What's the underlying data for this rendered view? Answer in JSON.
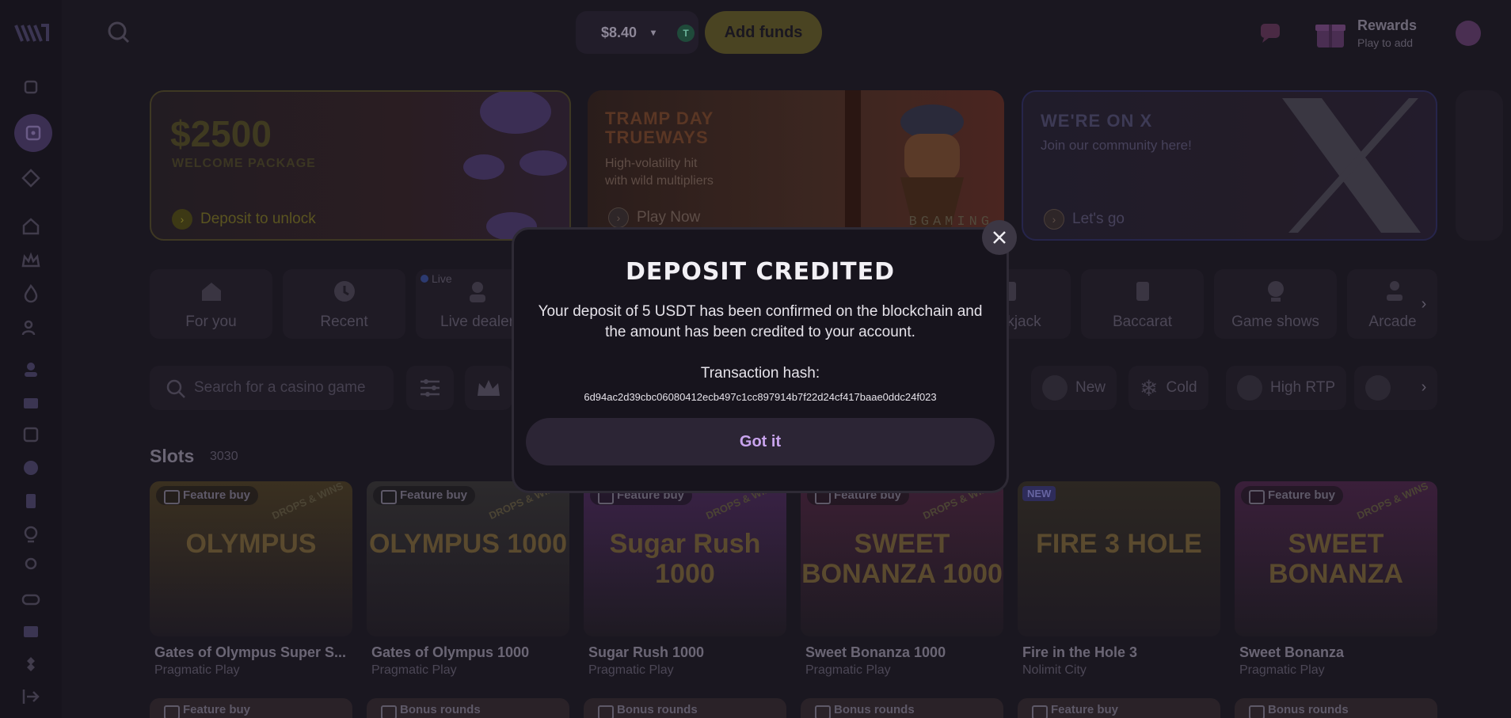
{
  "header": {
    "balance": "$8.40",
    "currency_badge": "T",
    "add_funds_label": "Add funds",
    "rewards_title": "Rewards",
    "rewards_sub": "Play to add"
  },
  "banners": [
    {
      "title": "$2500",
      "subtitle": "WELCOME PACKAGE",
      "cta": "Deposit to unlock"
    },
    {
      "title_line1": "TRAMP DAY",
      "title_line2": "TRUEWAYS",
      "desc_line1": "High-volatility hit",
      "desc_line2": "with wild multipliers",
      "cta": "Play Now",
      "brand": "BGAMING"
    },
    {
      "title": "WE'RE ON X",
      "desc": "Join our community here!",
      "cta": "Let's go"
    }
  ],
  "categories": [
    {
      "label": "For you",
      "icon": "house-icon"
    },
    {
      "label": "Recent",
      "icon": "clock-icon"
    },
    {
      "label": "Live dealer",
      "icon": "dealer-icon",
      "badge": "Live"
    },
    {
      "label": "Blackjack",
      "icon": "cards-icon"
    },
    {
      "label": "Baccarat",
      "icon": "card-icon"
    },
    {
      "label": "Game shows",
      "icon": "wheel-icon"
    },
    {
      "label": "Arcade",
      "icon": "joystick-icon"
    }
  ],
  "filters": {
    "search_placeholder": "Search for a casino game",
    "chips": [
      "New",
      "Cold",
      "High RTP"
    ]
  },
  "slots": {
    "title": "Slots",
    "count": "3030",
    "games": [
      {
        "name": "Gates of Olympus Super S...",
        "provider": "Pragmatic Play",
        "badge": "Feature buy",
        "art": "OLYMPUS",
        "color": "#3a3020"
      },
      {
        "name": "Gates of Olympus 1000",
        "provider": "Pragmatic Play",
        "badge": "Feature buy",
        "art": "OLYMPUS 1000",
        "color": "#2c2a2c"
      },
      {
        "name": "Sugar Rush 1000",
        "provider": "Pragmatic Play",
        "badge": "Feature buy",
        "art": "Sugar Rush 1000",
        "color": "#3a2246"
      },
      {
        "name": "Sweet Bonanza 1000",
        "provider": "Pragmatic Play",
        "badge": "Feature buy",
        "art": "SWEET BONANZA 1000",
        "color": "#3b1f33"
      },
      {
        "name": "Fire in the Hole 3",
        "provider": "Nolimit City",
        "badge": "NEW",
        "art": "FIRE 3 HOLE",
        "color": "#2c2722"
      },
      {
        "name": "Sweet Bonanza",
        "provider": "Pragmatic Play",
        "badge": "Feature buy",
        "art": "SWEET BONANZA",
        "color": "#3a1f3a"
      }
    ],
    "next_row_badges": [
      "Feature buy",
      "Bonus rounds",
      "Bonus rounds",
      "Bonus rounds",
      "Feature buy",
      "Bonus rounds"
    ],
    "drops_label": "DROPS & WINS"
  },
  "modal": {
    "title": "DEPOSIT CREDITED",
    "message": "Your deposit of 5 USDT has been confirmed on the blockchain and the amount has been credited to your account.",
    "hash_label": "Transaction hash:",
    "hash": "6d94ac2d39cbc06080412ecb497c1cc897914b7f22d24cf417baae0ddc24f023",
    "button": "Got it"
  }
}
